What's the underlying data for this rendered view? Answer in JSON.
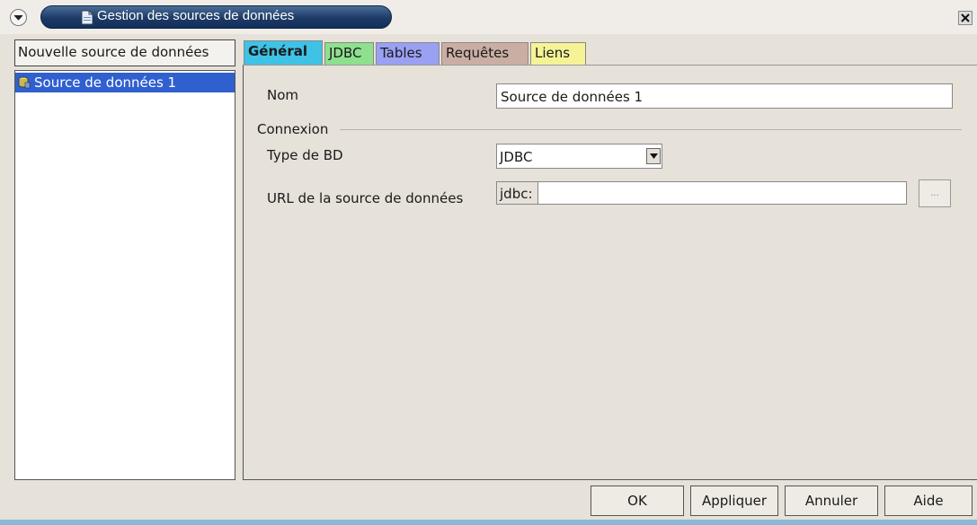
{
  "window": {
    "title": "Gestion des sources de données"
  },
  "sidebar": {
    "new_source_label": "Nouvelle source de données",
    "items": [
      {
        "label": "Source de données 1",
        "selected": true,
        "icon": "database-icon"
      }
    ]
  },
  "tabs": [
    {
      "label": "Général",
      "active": true,
      "color": "#3ec2e6"
    },
    {
      "label": "JDBC",
      "active": false,
      "color": "#8ee08e"
    },
    {
      "label": "Tables",
      "active": false,
      "color": "#9aa0f2"
    },
    {
      "label": "Requêtes",
      "active": false,
      "color": "#caaea4"
    },
    {
      "label": "Liens",
      "active": false,
      "color": "#f5f396"
    }
  ],
  "form": {
    "nom_label": "Nom",
    "nom_value": "Source de données 1",
    "connexion_label": "Connexion",
    "type_label": "Type de BD",
    "type_value": "JDBC",
    "url_label": "URL de la source de données",
    "url_prefix": "jdbc:",
    "url_value": "",
    "browse_label": "..."
  },
  "buttons": {
    "ok": "OK",
    "apply": "Appliquer",
    "cancel": "Annuler",
    "help": "Aide"
  },
  "colors": {
    "selection": "#3060d0",
    "titlebar_accent": "#1c3a66"
  }
}
